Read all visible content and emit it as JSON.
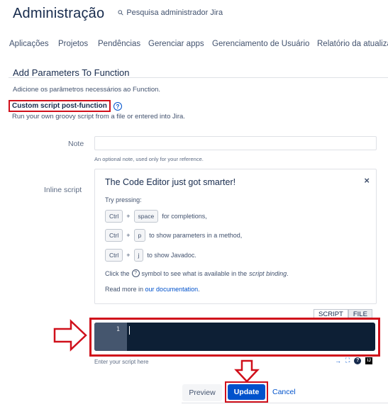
{
  "header": {
    "title": "Administração",
    "search_text": "Pesquisa administrador Jira"
  },
  "nav": {
    "tabs": [
      "Aplicações",
      "Projetos",
      "Pendências",
      "Gerenciar apps",
      "Gerenciamento de Usuário",
      "Relatório da atualiza"
    ]
  },
  "page": {
    "section_title": "Add Parameters To Function",
    "description": "Adicione os parâmetros necessários ao Function.",
    "function_label": "Custom script post-function",
    "function_desc": "Run your own groovy script from a file or entered into Jira."
  },
  "form": {
    "note_label": "Note",
    "note_value": "",
    "note_help": "An optional note, used only for your reference.",
    "inline_label": "Inline script"
  },
  "tip": {
    "title": "The Code Editor just got smarter!",
    "close": "×",
    "try": "Try pressing:",
    "rows": [
      {
        "key1": "Ctrl",
        "key2": "space",
        "desc": "for completions,"
      },
      {
        "key1": "Ctrl",
        "key2": "p",
        "desc": "to show parameters in a method,"
      },
      {
        "key1": "Ctrl",
        "key2": "j",
        "desc": "to show Javadoc."
      }
    ],
    "click_prefix": "Click the",
    "click_mid": "symbol to see what is available in the",
    "click_em": "script binding",
    "click_end": ".",
    "read_prefix": "Read more in",
    "read_link": "our documentation",
    "read_end": "."
  },
  "editor": {
    "toggle_script": "SCRIPT",
    "toggle_file": "FILE",
    "active_toggle": "FILE",
    "line_number": "1",
    "placeholder_hint": "Enter your script here"
  },
  "buttons": {
    "preview": "Preview",
    "update": "Update",
    "cancel": "Cancel"
  },
  "colors": {
    "accent": "#0052cc",
    "highlight": "#d0101b",
    "editor_bg": "#0d1f35",
    "gutter_bg": "#45566e"
  }
}
